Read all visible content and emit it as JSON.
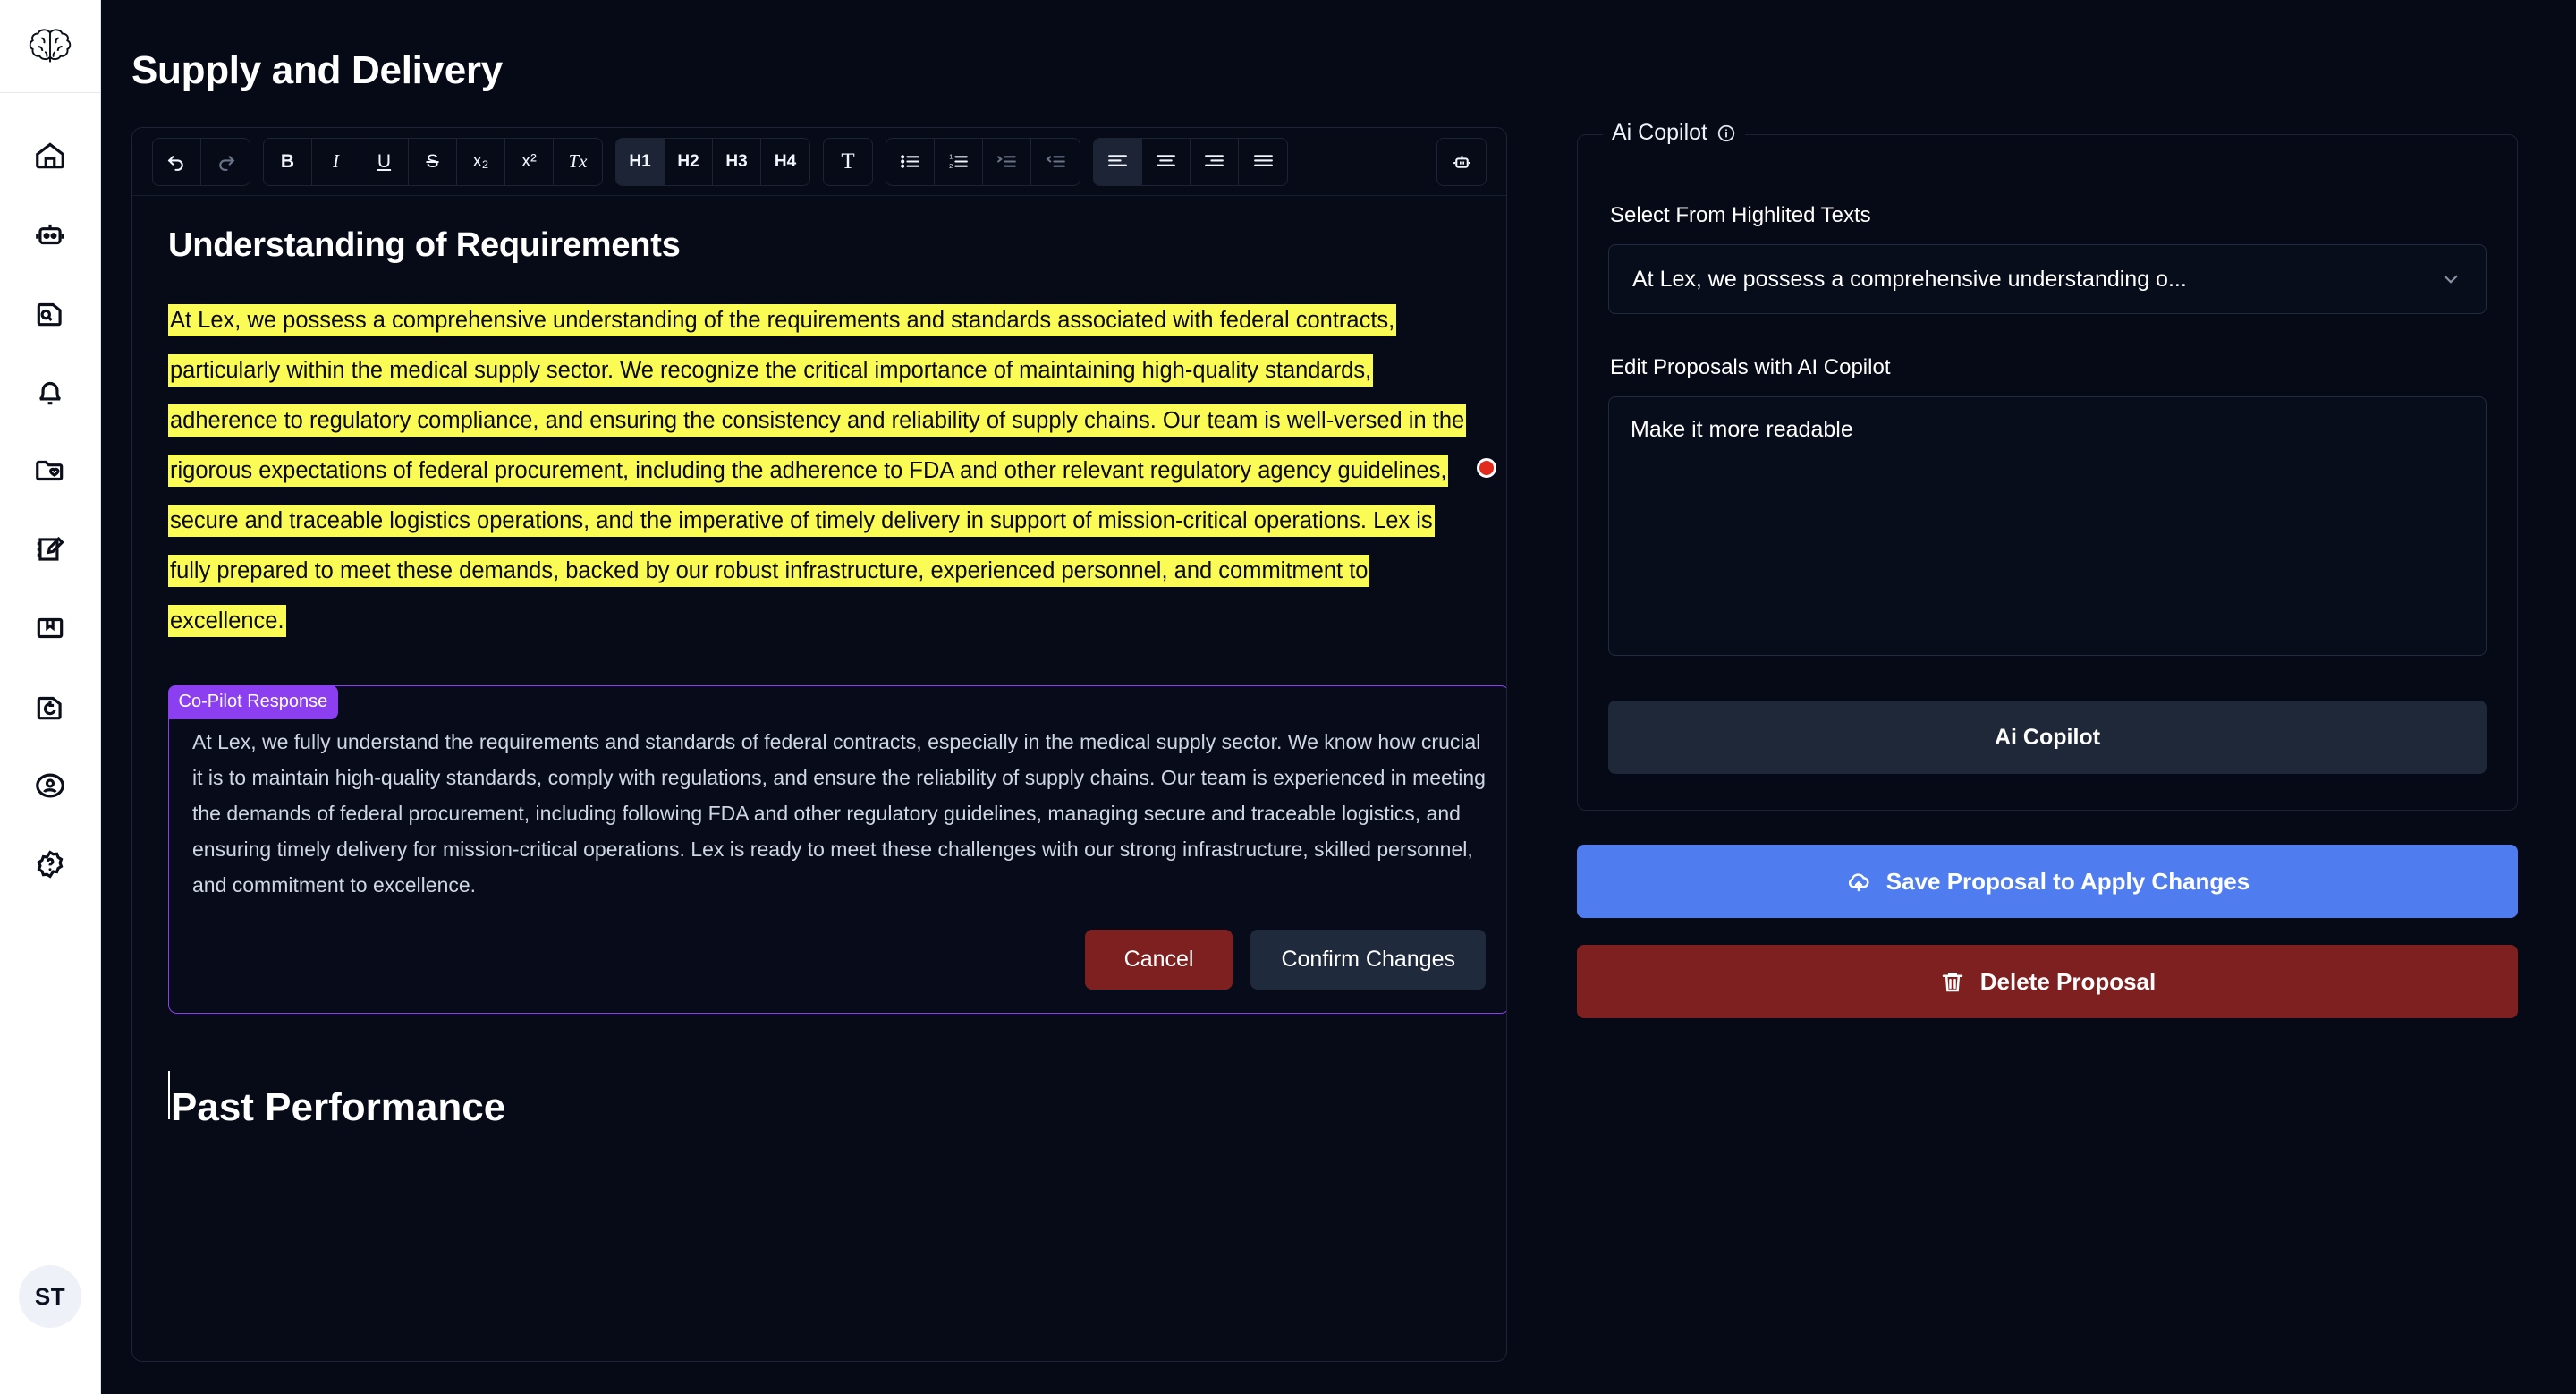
{
  "sidebar": {
    "brand_icon": "brain-logo",
    "items": [
      {
        "icon": "home-icon",
        "name": "home"
      },
      {
        "icon": "robot-icon",
        "name": "ai-assistant"
      },
      {
        "icon": "document-search-icon",
        "name": "document-search"
      },
      {
        "icon": "bell-icon",
        "name": "notifications"
      },
      {
        "icon": "folder-heart-icon",
        "name": "saved-folders"
      },
      {
        "icon": "notes-edit-icon",
        "name": "notes"
      },
      {
        "icon": "book-icon",
        "name": "library"
      },
      {
        "icon": "file-refresh-icon",
        "name": "file-sync"
      },
      {
        "icon": "user-circle-icon",
        "name": "account"
      },
      {
        "icon": "help-icon",
        "name": "help"
      }
    ],
    "avatar_initials": "ST"
  },
  "header": {
    "title": "Supply and Delivery"
  },
  "toolbar": {
    "groups": [
      {
        "name": "history",
        "buttons": [
          {
            "label": "",
            "icon": "undo-icon",
            "name": "undo-button",
            "state": "enabled"
          },
          {
            "label": "",
            "icon": "redo-icon",
            "name": "redo-button",
            "state": "disabled"
          }
        ]
      },
      {
        "name": "inline-format",
        "buttons": [
          {
            "label": "B",
            "name": "bold-button"
          },
          {
            "label": "I",
            "name": "italic-button"
          },
          {
            "label": "U",
            "name": "underline-button"
          },
          {
            "label": "S",
            "name": "strikethrough-button"
          },
          {
            "label": "x₂",
            "name": "subscript-button"
          },
          {
            "label": "x²",
            "name": "superscript-button"
          },
          {
            "label": "Tx",
            "name": "clear-format-button"
          }
        ]
      },
      {
        "name": "headings",
        "buttons": [
          {
            "label": "H1",
            "name": "heading-1-button",
            "active": true
          },
          {
            "label": "H2",
            "name": "heading-2-button",
            "active": false
          },
          {
            "label": "H3",
            "name": "heading-3-button",
            "active": false
          },
          {
            "label": "H4",
            "name": "heading-4-button",
            "active": false
          },
          {
            "label": "T",
            "name": "paragraph-button",
            "active": false
          }
        ]
      },
      {
        "name": "lists",
        "buttons": [
          {
            "label": "",
            "icon": "bullet-list-icon",
            "name": "bullet-list-button"
          },
          {
            "label": "",
            "icon": "numbered-list-icon",
            "name": "numbered-list-button"
          },
          {
            "label": "",
            "icon": "indent-icon",
            "name": "indent-button"
          },
          {
            "label": "",
            "icon": "outdent-icon",
            "name": "outdent-button"
          }
        ]
      },
      {
        "name": "alignment",
        "buttons": [
          {
            "label": "",
            "icon": "align-left-icon",
            "name": "align-left-button",
            "active": true
          },
          {
            "label": "",
            "icon": "align-center-icon",
            "name": "align-center-button",
            "active": false
          },
          {
            "label": "",
            "icon": "align-right-icon",
            "name": "align-right-button",
            "active": false
          },
          {
            "label": "",
            "icon": "align-justify-icon",
            "name": "align-justify-button",
            "active": false
          }
        ]
      }
    ],
    "ai_button": {
      "icon": "robot-icon",
      "name": "ai-copilot-toolbar-button"
    }
  },
  "document": {
    "heading": "Understanding of Requirements",
    "highlighted_paragraph": "At Lex, we possess a comprehensive understanding of the requirements and standards associated with federal contracts, particularly within the medical supply sector. We recognize the critical importance of maintaining high-quality standards, adherence to regulatory compliance, and ensuring the consistency and reliability of supply chains. Our team is well-versed in the rigorous expectations of federal procurement, including the adherence to FDA and other relevant regulatory agency guidelines, secure and traceable logistics operations, and the imperative of timely delivery in support of mission-critical operations. Lex is fully prepared to meet these demands, backed by our robust infrastructure, experienced personnel, and commitment to excellence.",
    "next_heading": "Past Performance",
    "marker_color": "#e02b1d",
    "highlight_color": "#fbfb56"
  },
  "copilot_response": {
    "badge": "Co-Pilot Response",
    "accent_color": "#8b3ff0",
    "text": "At Lex, we fully understand the requirements and standards of federal contracts, especially in the medical supply sector. We know how crucial it is to maintain high-quality standards, comply with regulations, and ensure the reliability of supply chains. Our team is experienced in meeting the demands of federal procurement, including following FDA and other regulatory guidelines, managing secure and traceable logistics, and ensuring timely delivery for mission-critical operations. Lex is ready to meet these challenges with our strong infrastructure, skilled personnel, and commitment to excellence.",
    "cancel_label": "Cancel",
    "confirm_label": "Confirm Changes"
  },
  "right_panel": {
    "legend": "Ai Copilot",
    "legend_icon": "info-icon",
    "select_label": "Select From Highlited Texts",
    "select_value": "At Lex, we possess a comprehensive understanding o...",
    "textarea_label": "Edit Proposals with AI Copilot",
    "textarea_value": "Make it more readable",
    "textarea_placeholder": "Edit Proposals with AI Copilot",
    "copilot_button": "Ai Copilot",
    "save_button": "Save Proposal to Apply Changes",
    "save_button_icon": "cloud-upload-icon",
    "save_button_color": "#4f7df0",
    "delete_button": "Delete Proposal",
    "delete_button_icon": "trash-icon",
    "delete_button_color": "#7e2020"
  }
}
